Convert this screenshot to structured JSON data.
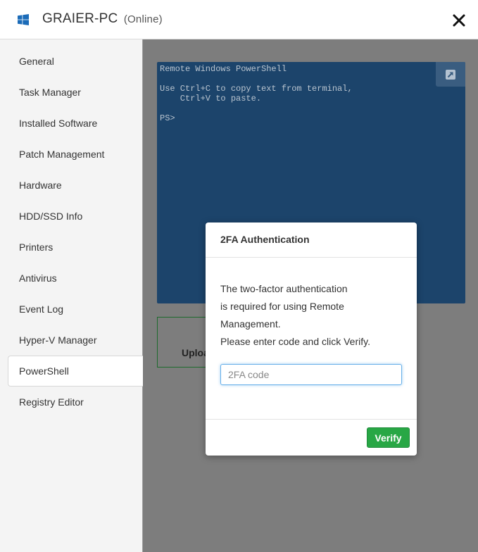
{
  "header": {
    "pc_name": "GRAIER-PC",
    "status": "(Online)"
  },
  "sidebar": {
    "items": [
      {
        "label": "General"
      },
      {
        "label": "Task Manager"
      },
      {
        "label": "Installed Software"
      },
      {
        "label": "Patch Management"
      },
      {
        "label": "Hardware"
      },
      {
        "label": "HDD/SSD Info"
      },
      {
        "label": "Printers"
      },
      {
        "label": "Antivirus"
      },
      {
        "label": "Event Log"
      },
      {
        "label": "Hyper-V Manager"
      },
      {
        "label": "PowerShell"
      },
      {
        "label": "Registry Editor"
      }
    ],
    "active": "PowerShell"
  },
  "terminal": {
    "text": "Remote Windows PowerShell\n\nUse Ctrl+C to copy text from terminal,\n    Ctrl+V to paste.\n\nPS>"
  },
  "upload": {
    "label": "Uploa"
  },
  "modal": {
    "title": "2FA Authentication",
    "lines": [
      "The two-factor authentication",
      "is required for using Remote",
      "Management.",
      "Please enter code and click Verify."
    ],
    "code_placeholder": "2FA code",
    "code_value": "",
    "verify_label": "Verify"
  },
  "colors": {
    "terminal_bg": "#1c446b",
    "overlay_bg": "#7d7d7d",
    "verify_bg": "#28a745",
    "windows_logo": "#1b6bb8"
  }
}
